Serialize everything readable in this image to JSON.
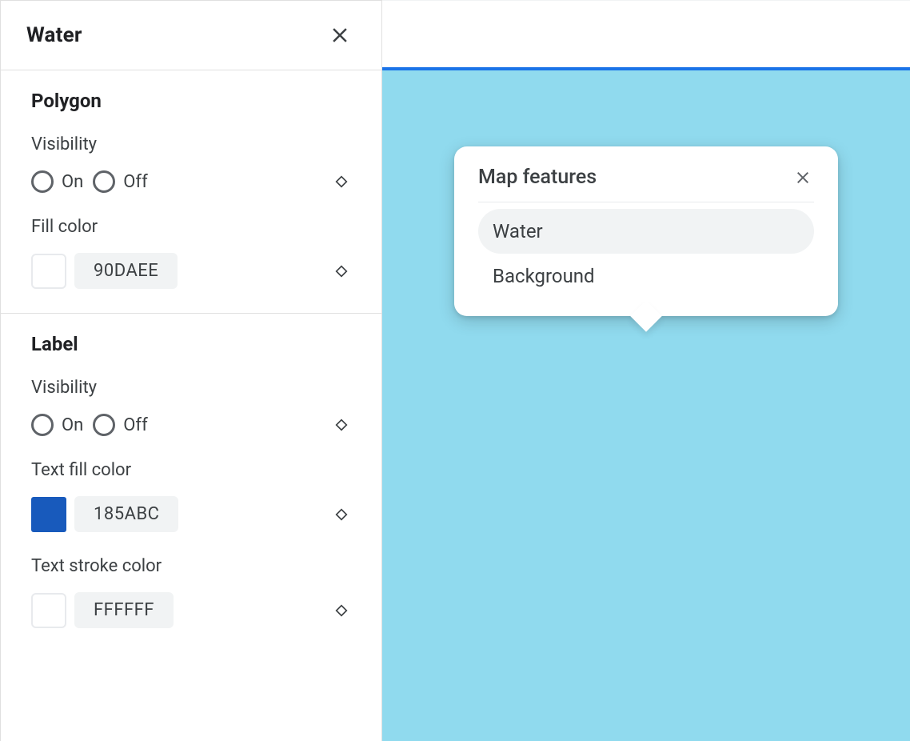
{
  "panel": {
    "title": "Water",
    "sections": {
      "polygon": {
        "heading": "Polygon",
        "visibility_label": "Visibility",
        "on": "On",
        "off": "Off",
        "fill_color_label": "Fill color",
        "fill_color_hex": "90DAEE",
        "fill_color_css": "#90DAEE"
      },
      "label": {
        "heading": "Label",
        "visibility_label": "Visibility",
        "on": "On",
        "off": "Off",
        "text_fill_label": "Text fill color",
        "text_fill_hex": "185ABC",
        "text_fill_css": "#185ABC",
        "text_stroke_label": "Text stroke color",
        "text_stroke_hex": "FFFFFF",
        "text_stroke_css": "#FFFFFF"
      }
    }
  },
  "preview": {
    "accent_color": "#1a73e8",
    "water_color": "#90DAEE",
    "popup": {
      "title": "Map features",
      "items": [
        {
          "label": "Water",
          "selected": true
        },
        {
          "label": "Background",
          "selected": false
        }
      ]
    }
  }
}
